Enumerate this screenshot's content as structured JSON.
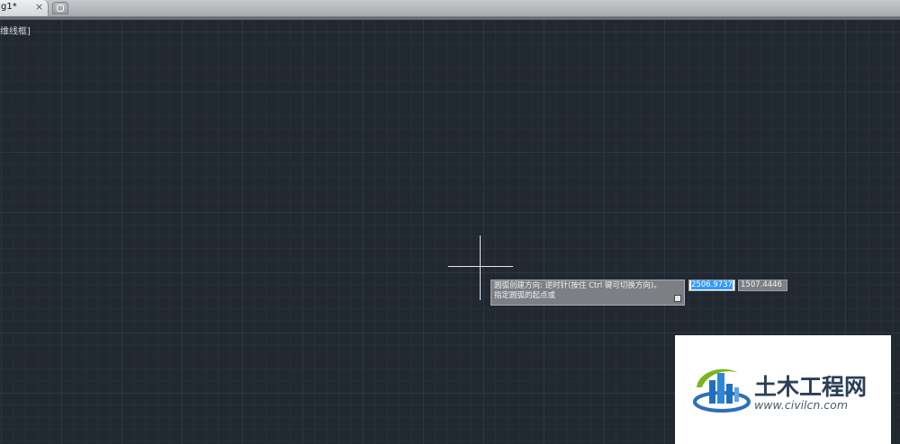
{
  "tabs": [
    {
      "label": "g1*",
      "close_symbol": "×",
      "active": true
    }
  ],
  "new_tab": {
    "icon": "new-drawing-icon"
  },
  "viewport": {
    "label": "维线框]"
  },
  "dynamic_input": {
    "prompt_line1": "圆弧创建方向: 逆时针(按住 Ctrl 键可切换方向)。",
    "prompt_line2": "指定圆弧的起点或",
    "x_value": "2506.9737",
    "y_value": "1507.4446",
    "expand_icon": "expand-options-icon"
  },
  "watermark": {
    "title": "土木工程网",
    "url": "www.civilcn.com"
  },
  "colors": {
    "canvas": "#212830",
    "selection": "#3399ff",
    "tooltip": "#7c7f84"
  }
}
